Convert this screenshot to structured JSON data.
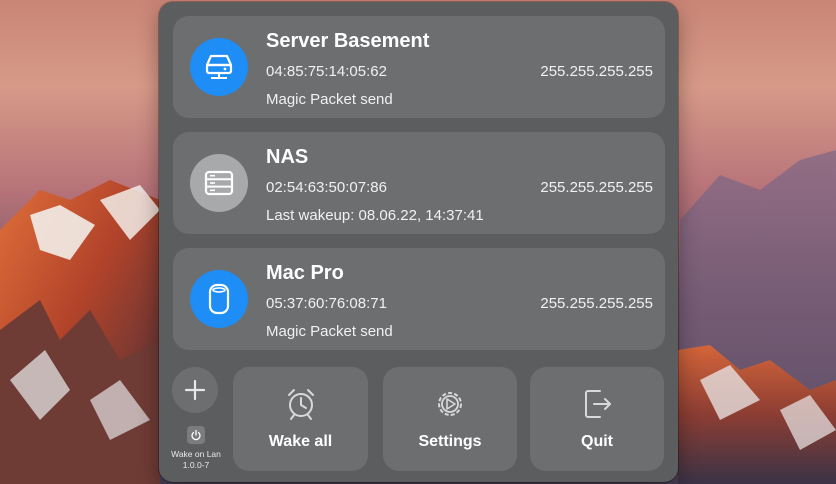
{
  "devices": [
    {
      "name": "Server Basement",
      "mac": "04:85:75:14:05:62",
      "ip": "255.255.255.255",
      "status": "Magic Packet send",
      "icon": "server-icon",
      "color": "#1e8df6"
    },
    {
      "name": "NAS",
      "mac": "02:54:63:50:07:86",
      "ip": "255.255.255.255",
      "status": "Last wakeup: 08.06.22, 14:37:41",
      "icon": "nas-icon",
      "color": "#a8a9ab"
    },
    {
      "name": "Mac Pro",
      "mac": "05:37:60:76:08:71",
      "ip": "255.255.255.255",
      "status": "Magic Packet send",
      "icon": "mac-pro-icon",
      "color": "#1e8df6"
    }
  ],
  "actions": {
    "wake_all": "Wake all",
    "settings": "Settings",
    "quit": "Quit"
  },
  "app": {
    "name": "Wake on Lan",
    "version": "1.0.0-7"
  }
}
